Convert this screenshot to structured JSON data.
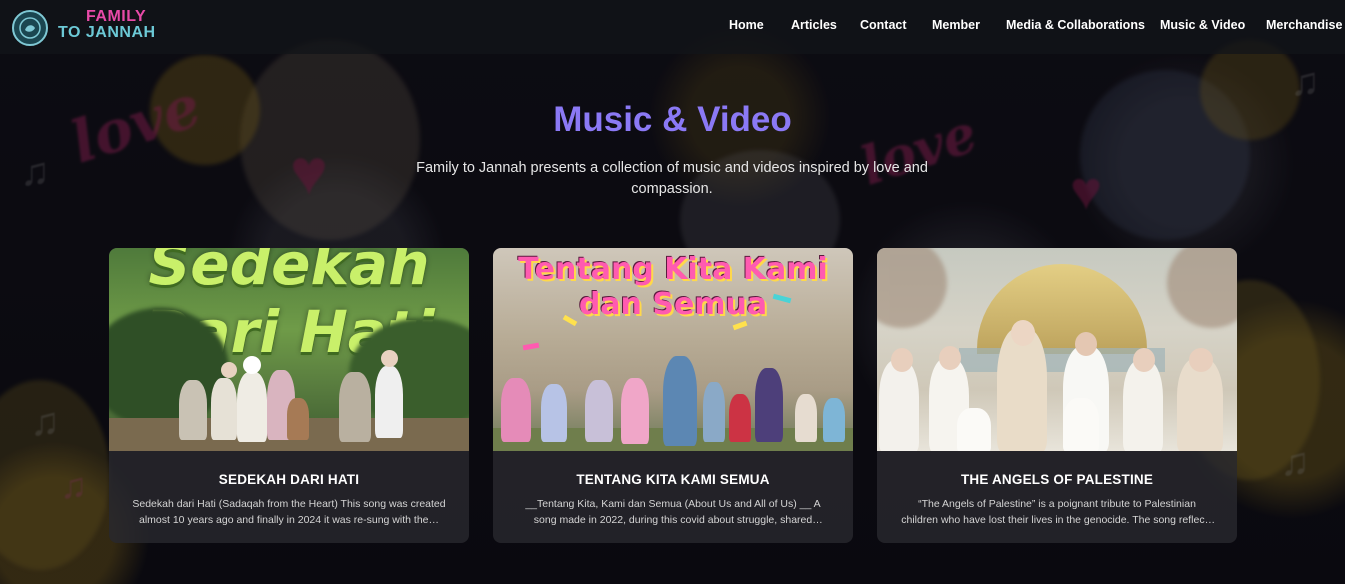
{
  "brand": {
    "line1": "FAMILY",
    "line2": "TO JANNAH",
    "mark_color": "#7fc8d4",
    "accent_pink": "#e84aa8",
    "accent_teal": "#6cc9d6"
  },
  "nav": {
    "items": [
      {
        "label": "Home"
      },
      {
        "label": "Articles"
      },
      {
        "label": "Contact"
      },
      {
        "label": "Member"
      },
      {
        "label": "Media & Collaborations"
      },
      {
        "label": "Music & Video"
      },
      {
        "label": "Merchandise"
      }
    ]
  },
  "hero": {
    "title": "Music & Video",
    "title_color": "#8b79f5",
    "intro": "Family to Jannah presents a collection of music and videos inspired by love and compassion."
  },
  "cards": [
    {
      "title": "SEDEKAH DARI HATI",
      "thumbnail_text": "Sedekah Dari Hati",
      "description": "Sedekah dari Hati (Sadaqah from the Heart) This song was created almost 10 years ago and finally in 2024 it was re-sung with the…"
    },
    {
      "title": "TENTANG KITA KAMI SEMUA",
      "thumbnail_text": "Tentang Kita Kami dan Semua",
      "description": "__Tentang Kita, Kami dan Semua (About Us and All of Us) __ A song made in 2022, during this covid about struggle, shared dreams . Th…"
    },
    {
      "title": "THE ANGELS OF PALESTINE",
      "description": "“The Angels of Palestine” is a poignant tribute to Palestinian children who have lost their lives in the genocide. The song reflects ffj's dee…"
    }
  ]
}
